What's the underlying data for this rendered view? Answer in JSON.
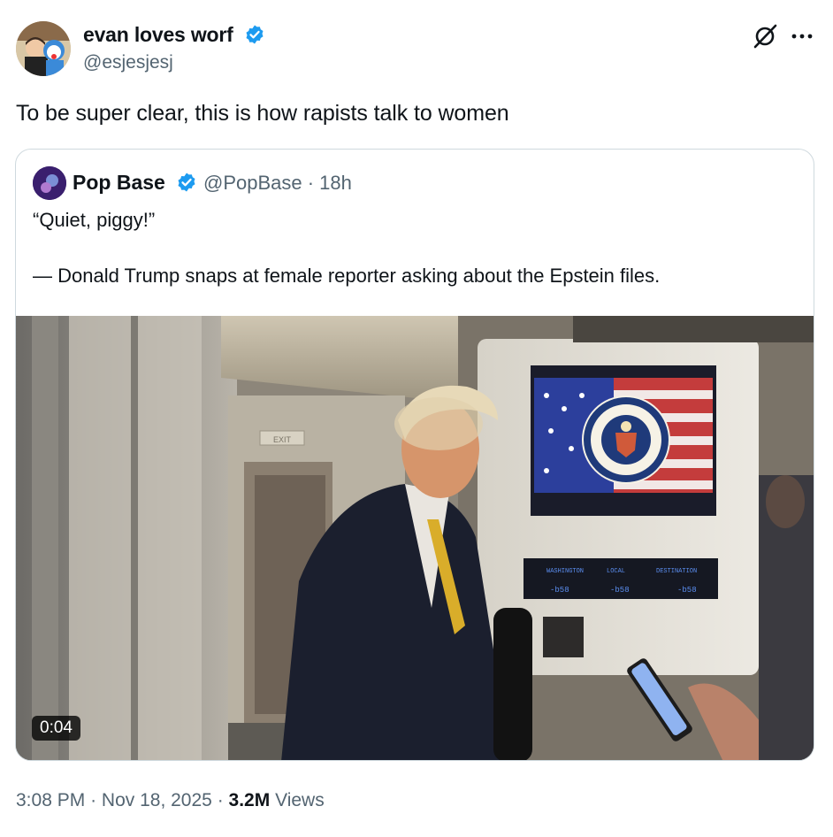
{
  "tweet": {
    "author_name": "evan loves worf",
    "author_handle": "@esjesjesj",
    "text": "To be super clear, this is how rapists talk to women",
    "time": "3:08 PM",
    "date": "Nov 18, 2025",
    "separator": "·",
    "views_count": "3.2M",
    "views_label": "Views"
  },
  "quoted": {
    "author_name": "Pop Base",
    "author_handle": "@PopBase",
    "age": "18h",
    "meta": "@PopBase · 18h",
    "quote_line": "“Quiet, piggy!”",
    "body_line": "— Donald Trump snaps at female reporter asking about the Epstein files.",
    "video_duration": "0:04",
    "video_screens": {
      "left": "WASHINGTON",
      "center": "LOCAL",
      "right": "DESTINATION",
      "time": "-b58"
    },
    "exit_sign": "EXIT"
  },
  "colors": {
    "verified_blue": "#1d9bf0",
    "secondary_text": "#536471",
    "primary_text": "#0f1419",
    "border": "#cfd9de"
  },
  "icons": {
    "verified": "verified-badge-icon",
    "grok": "grok-icon",
    "more": "more-icon"
  }
}
